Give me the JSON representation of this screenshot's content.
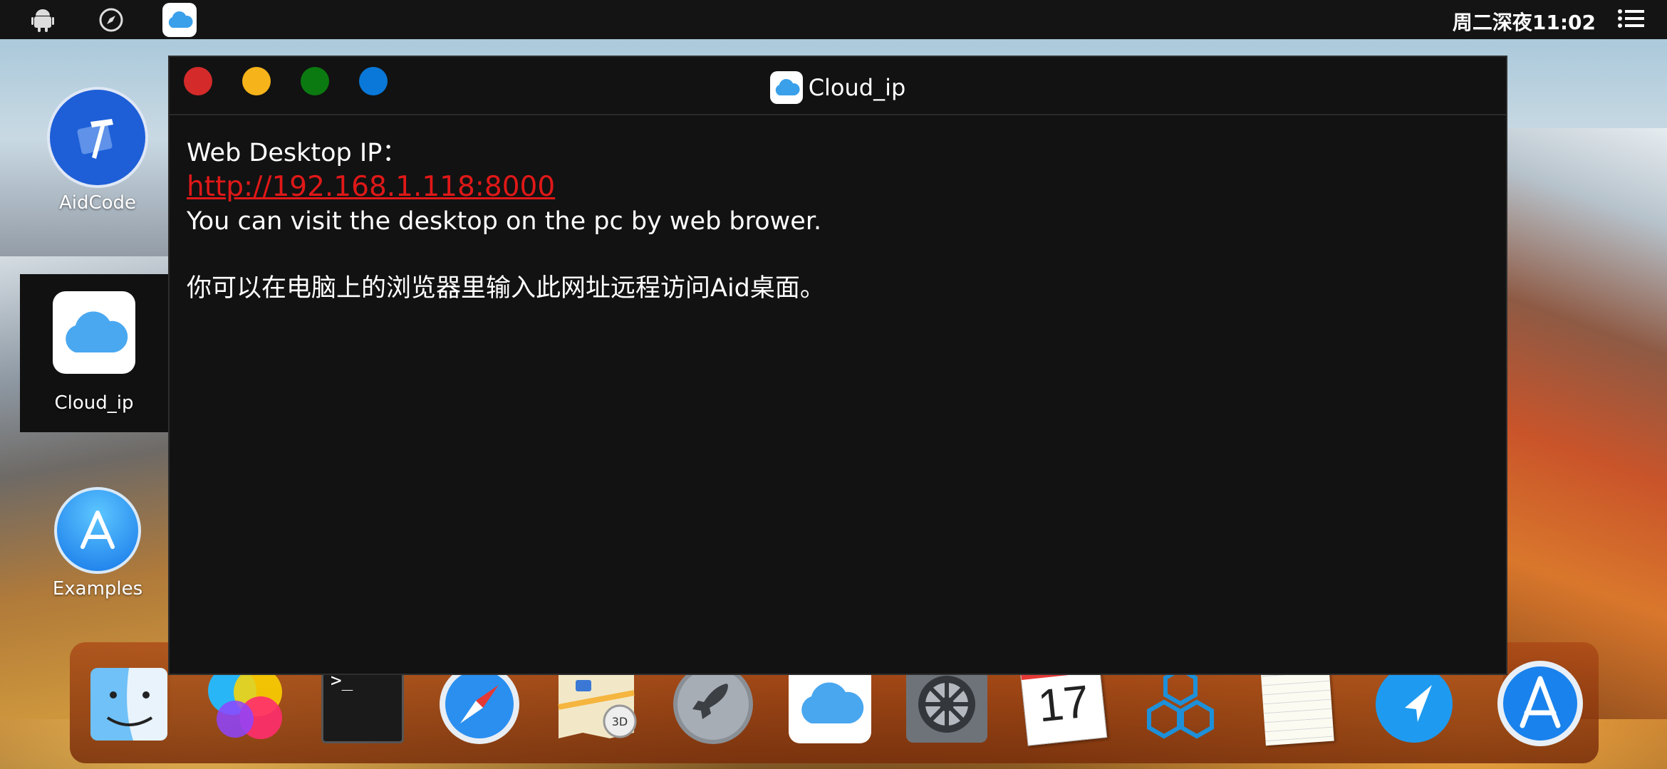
{
  "topbar": {
    "time": "周二深夜11:02",
    "icons": [
      "android-icon",
      "compass-icon",
      "cloud-icon",
      "menu-icon"
    ]
  },
  "desktop": {
    "items": [
      {
        "label": "AidCode",
        "icon": "hammer-app-icon"
      },
      {
        "label": "Cloud_ip",
        "icon": "cloud-icon"
      },
      {
        "label": "Examples",
        "icon": "app-store-icon"
      }
    ]
  },
  "window": {
    "title": "Cloud_ip",
    "heading": "Web Desktop IP：",
    "url": "http://192.168.1.118:8000",
    "line_en": "You can visit the desktop on the pc by web brower.",
    "line_zh": "你可以在电脑上的浏览器里输入此网址远程访问Aid桌面。"
  },
  "dock": {
    "items": [
      "finder-icon",
      "game-center-icon",
      "terminal-icon",
      "safari-icon",
      "maps-icon",
      "launchpad-icon",
      "icloud-icon",
      "system-preferences-icon",
      "calendar-icon",
      "blocks-icon",
      "notes-icon",
      "location-icon",
      "app-store-icon"
    ],
    "calendar_day": "17",
    "terminal_prompt": ">_"
  },
  "colors": {
    "link": "#e01818",
    "traffic": [
      "#d42a2a",
      "#f7b31a",
      "#0b7a10",
      "#0a78d8"
    ]
  }
}
